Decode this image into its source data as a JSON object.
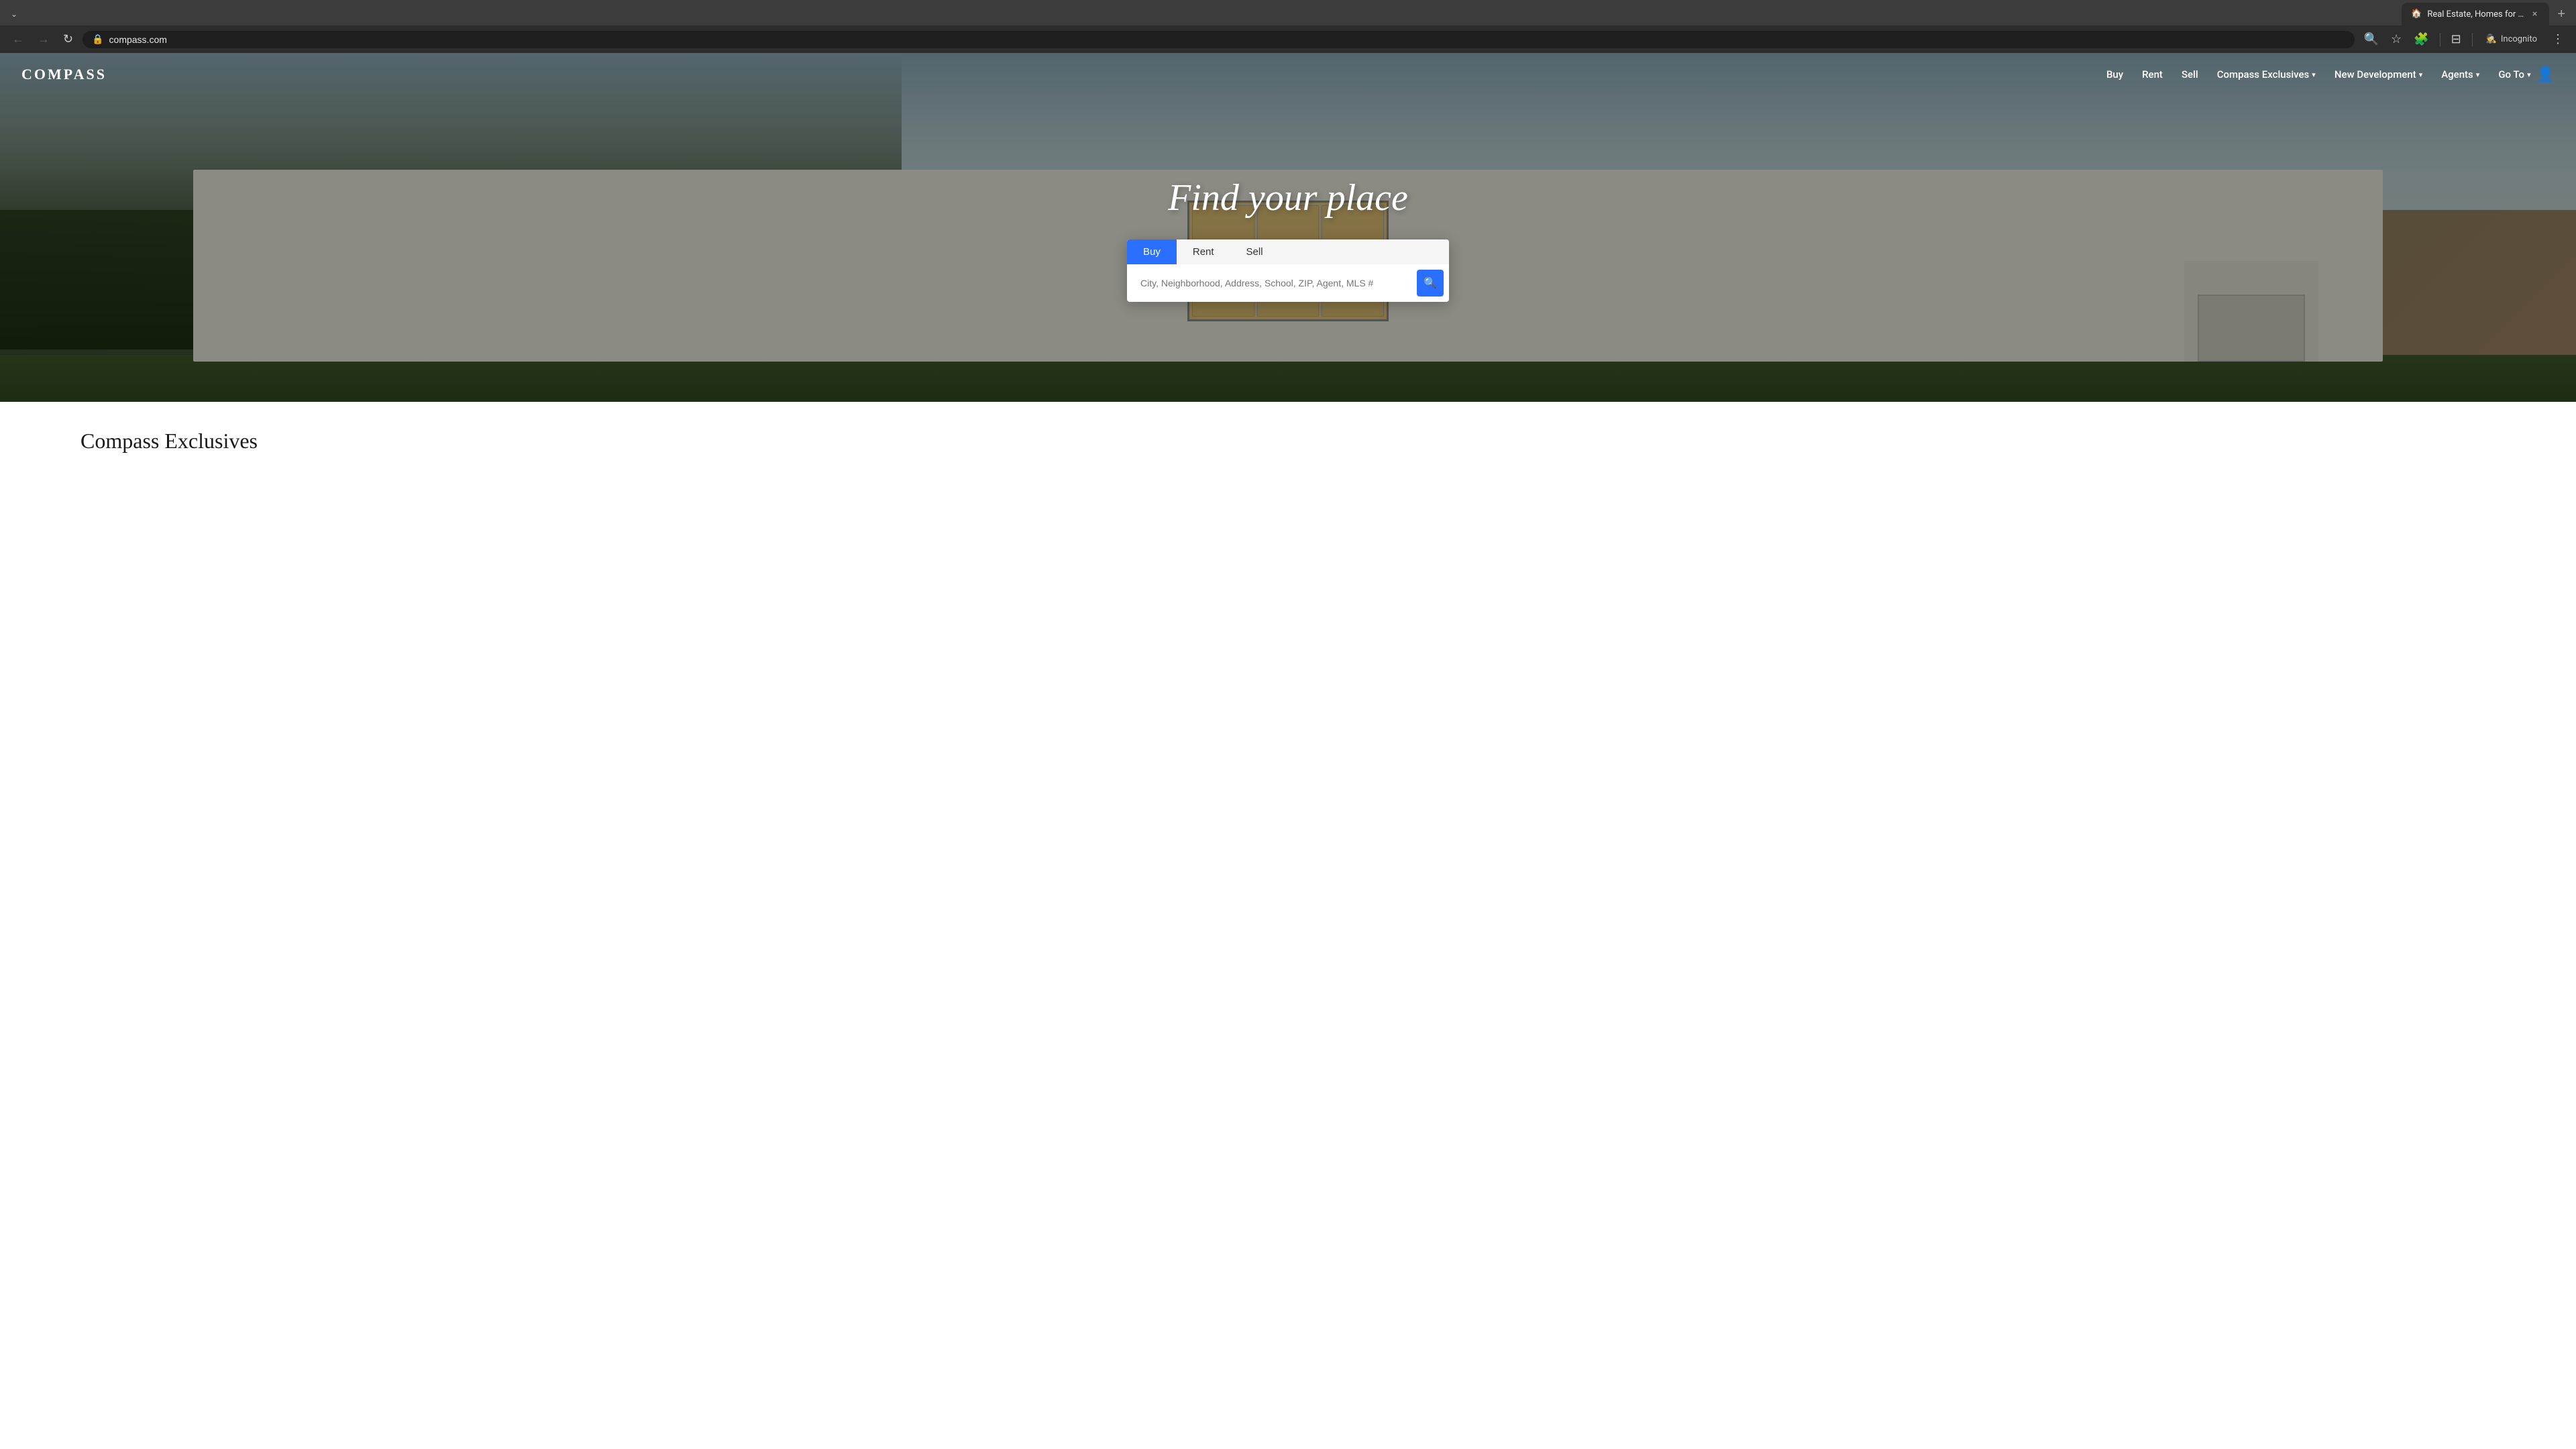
{
  "browser": {
    "tab": {
      "title": "Real Estate, Homes for Sale & A",
      "favicon": "🏠"
    },
    "url": "compass.com",
    "window_controls": {
      "close": "×",
      "maximize": "□",
      "minimize": "−"
    },
    "toolbar": {
      "back_icon": "←",
      "forward_icon": "→",
      "refresh_icon": "↻",
      "search_icon": "🔍",
      "star_icon": "☆",
      "extensions_icon": "🧩",
      "profile_icon": "👤",
      "menu_icon": "⋮",
      "incognito_label": "Incognito",
      "incognito_icon": "🕵"
    }
  },
  "site": {
    "logo": "COMPASS",
    "nav": {
      "buy": "Buy",
      "rent": "Rent",
      "sell": "Sell",
      "compass_exclusives": "Compass Exclusives",
      "new_development": "New Development",
      "agents": "Agents",
      "goto": "Go To"
    },
    "hero": {
      "title": "Find your place"
    },
    "search": {
      "tabs": [
        "Buy",
        "Rent",
        "Sell"
      ],
      "active_tab": "Buy",
      "placeholder": "City, Neighborhood, Address, School, ZIP, Agent, MLS #",
      "button_icon": "🔍"
    },
    "below_section": {
      "title": "Compass Exclusives"
    }
  }
}
